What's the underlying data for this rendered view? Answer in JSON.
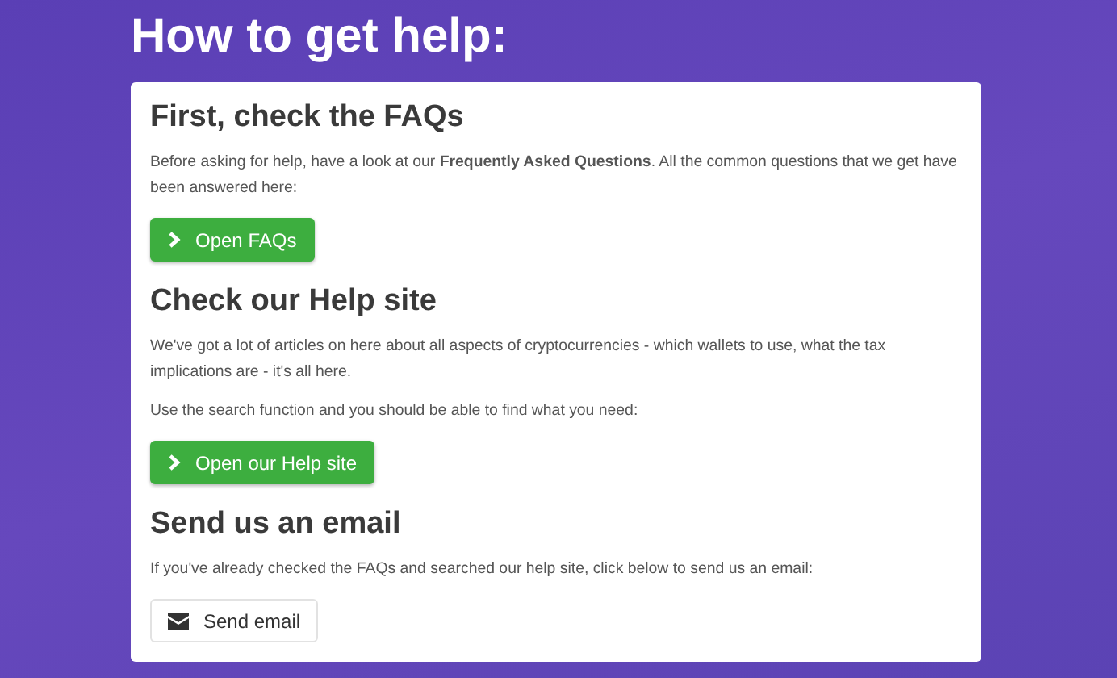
{
  "page_title": "How to get help:",
  "sections": [
    {
      "heading": "First, check the FAQs",
      "paragraphs": [
        "Before asking for help, have a look at our **Frequently Asked Questions**. All the common questions that we get have been answered here:"
      ],
      "button": {
        "label": "Open FAQs",
        "kind": "primary"
      }
    },
    {
      "heading": "Check our Help site",
      "paragraphs": [
        "We've got a lot of articles on here about all aspects of cryptocurrencies - which wallets to use, what the tax implications are - it's all here.",
        "Use the search function and you should be able to find what you need:"
      ],
      "button": {
        "label": "Open our Help site",
        "kind": "primary"
      }
    },
    {
      "heading": "Send us an email",
      "paragraphs": [
        "If you've already checked the FAQs and searched our help site, click below to send us an email:"
      ],
      "button": {
        "label": "Send email",
        "kind": "default"
      }
    }
  ]
}
